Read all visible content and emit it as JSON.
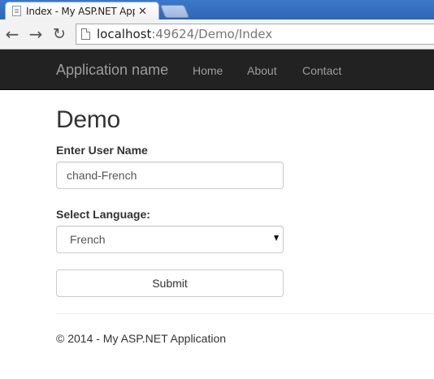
{
  "browser": {
    "tab_title": "Index - My ASP.NET Appli",
    "tab_close_icon": "close-icon",
    "url_host": "localhost",
    "url_rest": ":49624/Demo/Index"
  },
  "navbar": {
    "brand": "Application name",
    "links": [
      "Home",
      "About",
      "Contact"
    ],
    "background": "#222222",
    "link_color": "#9d9d9d"
  },
  "page": {
    "heading": "Demo",
    "user_label": "Enter User Name",
    "user_value": "chand-French",
    "language_label": "Select Language:",
    "language_selected": "French",
    "submit_label": "Submit"
  },
  "footer": {
    "text": "© 2014 - My ASP.NET Application"
  }
}
